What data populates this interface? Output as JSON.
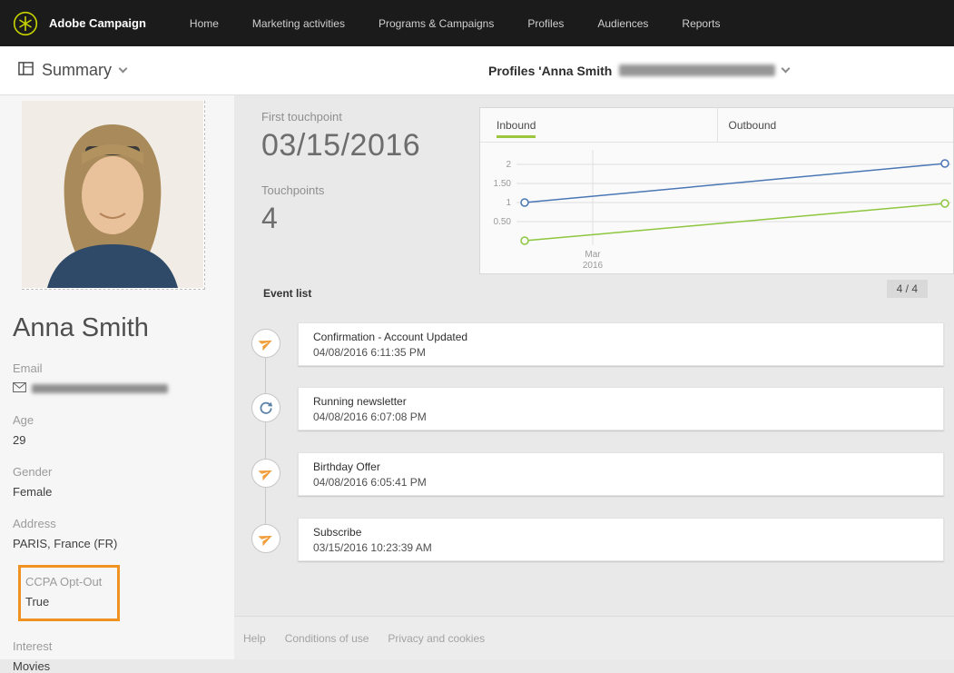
{
  "topbar": {
    "brand": "Adobe Campaign",
    "nav": [
      "Home",
      "Marketing activities",
      "Programs & Campaigns",
      "Profiles",
      "Audiences",
      "Reports"
    ]
  },
  "subbar": {
    "view_label": "Summary",
    "profile_title": "Profiles 'Anna Smith"
  },
  "sidebar": {
    "name": "Anna Smith",
    "fields": [
      {
        "label": "Email",
        "value": "",
        "redacted": true
      },
      {
        "label": "Age",
        "value": "29"
      },
      {
        "label": "Gender",
        "value": "Female"
      },
      {
        "label": "Address",
        "value": "PARIS, France (FR)"
      },
      {
        "label": "CCPA Opt-Out",
        "value": "True",
        "highlighted": true
      },
      {
        "label": "Interest",
        "value": "Movies"
      }
    ],
    "highlight_color": "#ef9222"
  },
  "kpis": {
    "first_touchpoint_label": "First touchpoint",
    "first_touchpoint_value": "03/15/2016",
    "touchpoints_label": "Touchpoints",
    "touchpoints_value": "4"
  },
  "chart_data": {
    "type": "line",
    "tabs": [
      {
        "label": "Inbound",
        "active": true
      },
      {
        "label": "Outbound",
        "active": false
      }
    ],
    "x": [
      "03/15/2016",
      "04/08/2016"
    ],
    "series": [
      {
        "name": "blue-line",
        "color": "#4a77b4",
        "values": [
          1,
          2
        ]
      },
      {
        "name": "green-line",
        "color": "#8dc63f",
        "values": [
          0,
          1
        ]
      }
    ],
    "ylim": [
      0,
      2.25
    ],
    "ytick_labels": [
      "2",
      "1.50",
      "1",
      "0.50"
    ],
    "xtick": {
      "line1": "Mar",
      "line2": "2016"
    },
    "grid": true,
    "legend_position": "none",
    "active_tab_underline_color": "#9bc63d"
  },
  "events": {
    "header": "Event list",
    "count": "4 / 4",
    "items": [
      {
        "title": "Confirmation - Account Updated",
        "date": "04/08/2016 6:11:35 PM",
        "icon": "paper-plane"
      },
      {
        "title": "Running newsletter",
        "date": "04/08/2016 6:07:08 PM",
        "icon": "recurring-delivery"
      },
      {
        "title": "Birthday Offer",
        "date": "04/08/2016 6:05:41 PM",
        "icon": "paper-plane"
      },
      {
        "title": "Subscribe",
        "date": "03/15/2016 10:23:39 AM",
        "icon": "paper-plane"
      }
    ]
  },
  "footer": {
    "links": [
      "Help",
      "Conditions of use",
      "Privacy and cookies"
    ]
  },
  "icons": {
    "paper-plane": "orange send glyph #f09e3c",
    "recurring-delivery": "blue sync arrows #5b82a8",
    "envelope": "mail outline",
    "summary-view": "panel layout square"
  }
}
